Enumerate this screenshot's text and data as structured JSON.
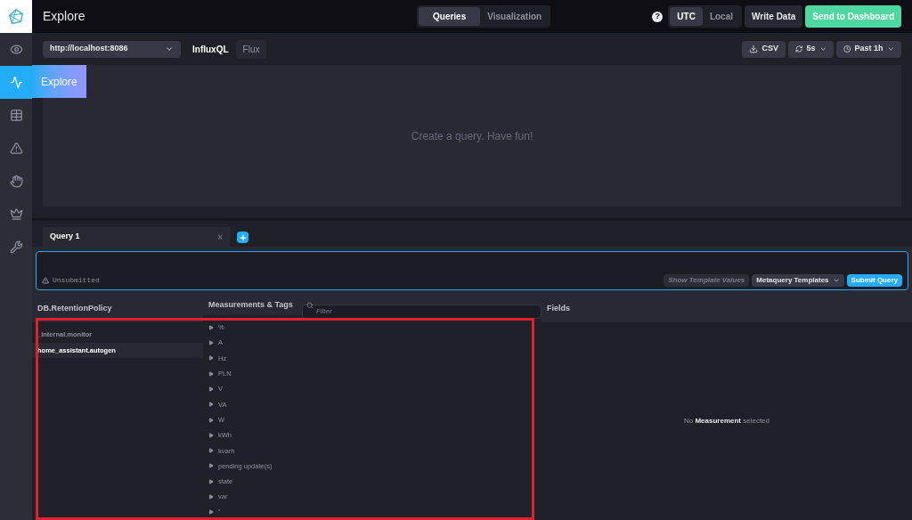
{
  "header": {
    "title": "Explore",
    "view_tabs": [
      {
        "label": "Queries",
        "selected": true
      },
      {
        "label": "Visualization",
        "selected": false
      }
    ],
    "timezone": [
      {
        "label": "UTC",
        "selected": true
      },
      {
        "label": "Local",
        "selected": false
      }
    ],
    "help": "?",
    "write_button": "Write Data",
    "send_button": "Send to Dashboard"
  },
  "sidebar": {
    "items": [
      {
        "selected": false
      },
      {
        "selected": true,
        "tooltip": "Explore"
      },
      {
        "selected": false
      },
      {
        "selected": false
      },
      {
        "selected": false
      },
      {
        "selected": false
      },
      {
        "selected": false
      }
    ]
  },
  "toolbar": {
    "source": "http://localhost:8086",
    "languages": [
      {
        "label": "InfluxQL",
        "selected": true
      },
      {
        "label": "Flux",
        "selected": false
      }
    ],
    "csv": "CSV",
    "refresh": "5s",
    "range": "Past 1h"
  },
  "graph": {
    "empty_message": "Create a query. Have fun!"
  },
  "query_tabs": [
    {
      "label": "Query 1",
      "selected": true,
      "close": "×"
    }
  ],
  "editor": {
    "status": "Unsubmitted",
    "template_values": "Show Template Values",
    "metaquery": "Metaquery Templates",
    "submit": "Submit Query"
  },
  "db_column": {
    "heading": "DB.RetentionPolicy",
    "items": [
      {
        "label": "_internal.monitor",
        "selected": false
      },
      {
        "label": "home_assistant.autogen",
        "selected": true
      }
    ]
  },
  "measurements_column": {
    "heading": "Measurements & Tags",
    "filter_placeholder": "Filter",
    "items": [
      {
        "label": "%"
      },
      {
        "label": "A"
      },
      {
        "label": "Hz"
      },
      {
        "label": "PLN"
      },
      {
        "label": "V"
      },
      {
        "label": "VA"
      },
      {
        "label": "W"
      },
      {
        "label": "kWh"
      },
      {
        "label": "kvarh"
      },
      {
        "label": "pending update(s)"
      },
      {
        "label": "state"
      },
      {
        "label": "var"
      },
      {
        "label": "˚"
      }
    ]
  },
  "fields_column": {
    "heading": "Fields",
    "empty_message": "No **Measurement** selected"
  }
}
